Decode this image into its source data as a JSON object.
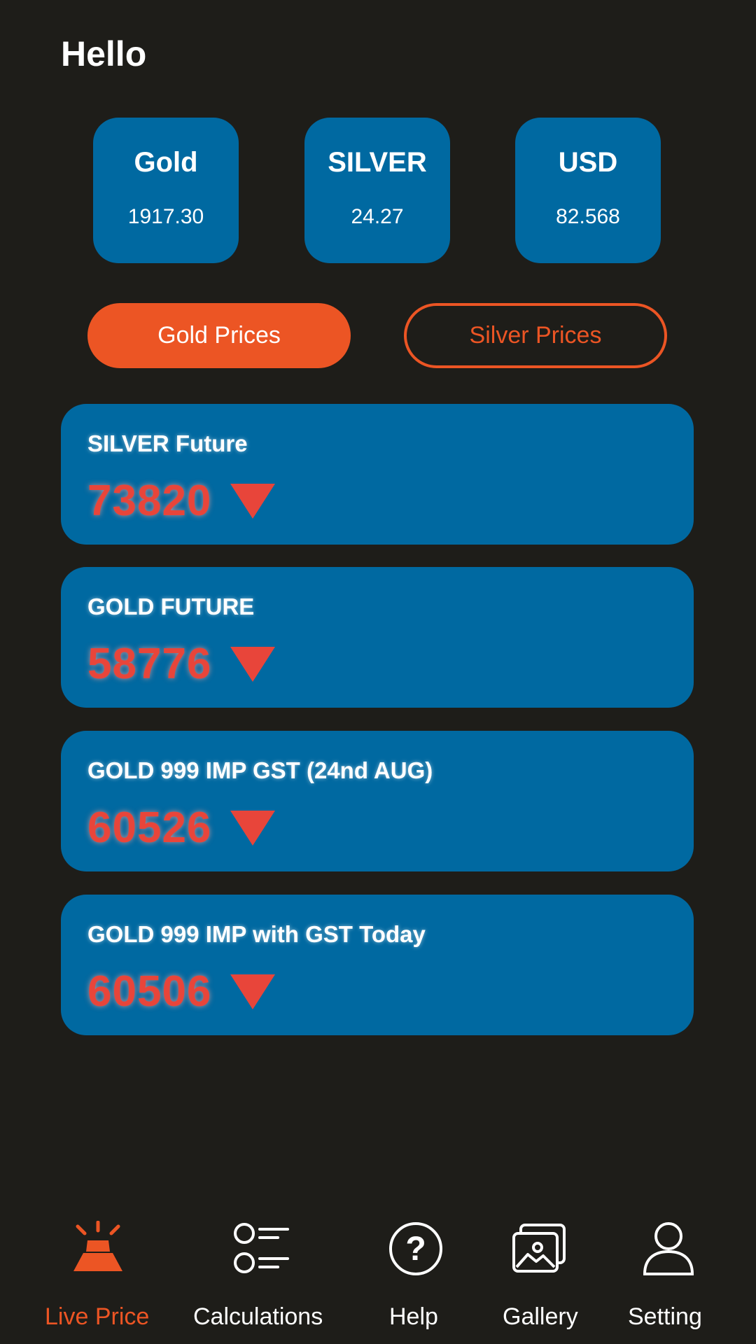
{
  "header": {
    "greeting": "Hello"
  },
  "tiles": [
    {
      "name": "Gold",
      "value": "1917.30"
    },
    {
      "name": "SILVER",
      "value": "24.27"
    },
    {
      "name": "USD",
      "value": "82.568"
    }
  ],
  "toggles": {
    "gold_label": "Gold Prices",
    "silver_label": "Silver Prices",
    "active": "gold"
  },
  "cards": [
    {
      "title": "SILVER Future",
      "value": "73820",
      "trend": "down"
    },
    {
      "title": "GOLD FUTURE",
      "value": "58776",
      "trend": "down"
    },
    {
      "title": "GOLD 999 IMP GST (24nd AUG)",
      "value": "60526",
      "trend": "down"
    },
    {
      "title": "GOLD 999 IMP with GST Today",
      "value": "60506",
      "trend": "down"
    }
  ],
  "nav": {
    "items": [
      {
        "label": "Live Price",
        "icon": "gold-bar-icon",
        "active": true
      },
      {
        "label": "Calculations",
        "icon": "list-icon",
        "active": false
      },
      {
        "label": "Help",
        "icon": "help-icon",
        "active": false
      },
      {
        "label": "Gallery",
        "icon": "gallery-icon",
        "active": false
      },
      {
        "label": "Setting",
        "icon": "user-icon",
        "active": false
      }
    ]
  },
  "colors": {
    "background": "#1e1d19",
    "card": "#0069a1",
    "accent": "#ec5524",
    "down": "#e8453a",
    "text": "#ffffff"
  }
}
